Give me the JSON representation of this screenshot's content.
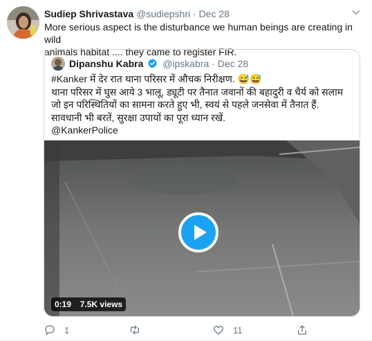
{
  "tweet": {
    "author_name": "Sudiep Shrivastava",
    "author_handle": "@sudiepshri",
    "separator": "·",
    "date": "Dec 28",
    "text_lines": [
      "More serious aspect is the disturbance we human beings are creating in wild",
      "animals habitat .... they came to register FIR."
    ]
  },
  "quoted_tweet": {
    "author_name": "Dipanshu Kabra",
    "author_handle": "@ipskabra",
    "separator": "·",
    "date": "Dec 28",
    "text_lines": [
      "#Kanker में देर रात थाना परिसर में औचक निरीक्षण. 😅😅",
      "थाना परिसर में घुस आये 3 भालू, ड्यूटी पर तैनात जवानों की बहादुरी व धैर्य को सलाम",
      "जो इन परिस्थितियों का सामना करते हुए भी, स्वयं से पहले जनसेवा में तैनात हैं.",
      "सावधानी भी बरतें, सुरक्षा उपायों का पूरा ध्यान रखें.",
      "@KankerPolice"
    ],
    "video": {
      "duration": "0:19",
      "views": "7.5K views"
    }
  },
  "actions": {
    "reply_count": "1",
    "retweet_count": "",
    "like_count": "11"
  },
  "colors": {
    "brand": "#1da1f2",
    "text": "#14171a",
    "secondary": "#657786",
    "border": "#ccd6dd"
  },
  "icons": [
    "more-icon",
    "verified-icon",
    "play-icon",
    "reply-icon",
    "retweet-icon",
    "like-icon",
    "share-icon"
  ]
}
